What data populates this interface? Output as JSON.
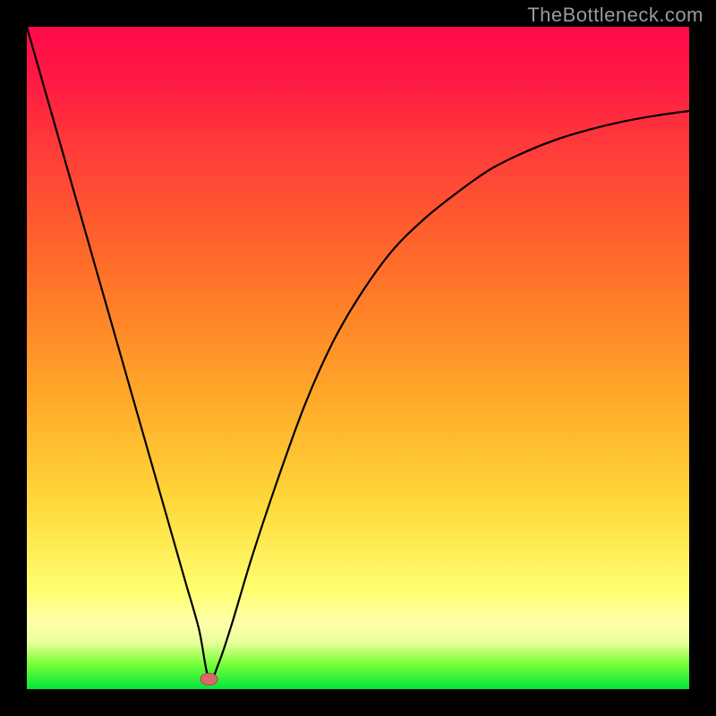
{
  "watermark": "TheBottleneck.com",
  "chart_data": {
    "type": "line",
    "title": "",
    "xlabel": "",
    "ylabel": "",
    "xlim": [
      0,
      100
    ],
    "ylim": [
      0,
      100
    ],
    "grid": false,
    "legend": false,
    "background_gradient": {
      "direction": "top-to-bottom",
      "stops": [
        {
          "pos": 0.0,
          "color": "#ff0a4a"
        },
        {
          "pos": 0.35,
          "color": "#ff6a2a"
        },
        {
          "pos": 0.72,
          "color": "#ffd93a"
        },
        {
          "pos": 0.9,
          "color": "#ffffaa"
        },
        {
          "pos": 1.0,
          "color": "#00e63a"
        }
      ]
    },
    "series": [
      {
        "name": "bottleneck-curve",
        "x": [
          0,
          2,
          4,
          6,
          8,
          10,
          12,
          14,
          16,
          18,
          20,
          22,
          24,
          26,
          27.5,
          29,
          31,
          34,
          38,
          42,
          46,
          50,
          55,
          60,
          65,
          70,
          75,
          80,
          85,
          90,
          95,
          100
        ],
        "y": [
          100,
          93,
          86,
          79,
          72,
          65,
          58,
          51,
          44,
          37,
          30,
          23,
          16,
          9,
          1.5,
          4,
          10,
          20,
          32,
          43,
          52,
          59,
          66,
          71,
          75,
          78.5,
          81,
          83,
          84.5,
          85.7,
          86.6,
          87.3
        ],
        "color": "#000000",
        "line_width": 2.2
      }
    ],
    "markers": [
      {
        "name": "minimum-point",
        "x": 27.5,
        "y": 1.5,
        "shape": "ellipse",
        "rx": 1.3,
        "ry": 0.9,
        "color": "#d66a6a"
      }
    ]
  }
}
